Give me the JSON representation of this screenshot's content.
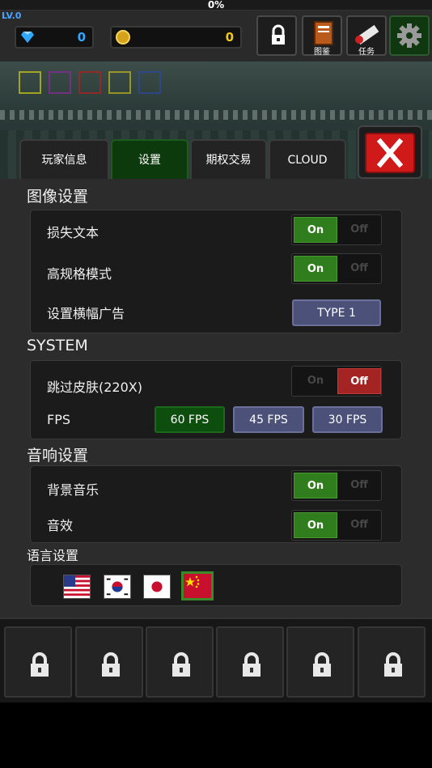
{
  "status": {
    "xp_percent_text": "0%",
    "level": "LV.0"
  },
  "currency": {
    "gems": "0",
    "coins": "0"
  },
  "top_buttons": [
    {
      "name": "lock",
      "caption": ""
    },
    {
      "name": "encyclopedia",
      "caption": "图鉴"
    },
    {
      "name": "quests",
      "caption": "任务"
    },
    {
      "name": "settings",
      "caption": ""
    }
  ],
  "tabs": [
    {
      "label": "玩家信息",
      "active": false
    },
    {
      "label": "设置",
      "active": true
    },
    {
      "label": "期权交易",
      "active": false
    },
    {
      "label": "CLOUD",
      "active": false
    }
  ],
  "graphics": {
    "title": "图像设置",
    "rows": [
      {
        "label": "损失文本",
        "on": "On",
        "off": "Off",
        "state": "on"
      },
      {
        "label": "高规格模式",
        "on": "On",
        "off": "Off",
        "state": "on"
      }
    ],
    "banner": {
      "label": "设置横幅广告",
      "button": "TYPE 1"
    }
  },
  "system": {
    "title": "SYSTEM",
    "skip_skin": {
      "label": "跳过皮肤(220X)",
      "on": "On",
      "off": "Off",
      "state": "off"
    },
    "fps": {
      "label": "FPS",
      "options": [
        "60 FPS",
        "45 FPS",
        "30 FPS"
      ],
      "selected": "60 FPS"
    }
  },
  "audio": {
    "title": "音响设置",
    "rows": [
      {
        "label": "背景音乐",
        "on": "On",
        "off": "Off",
        "state": "on"
      },
      {
        "label": "音效",
        "on": "On",
        "off": "Off",
        "state": "on"
      }
    ]
  },
  "language": {
    "title": "语言设置",
    "flags": [
      "us-flag",
      "kr-flag",
      "jp-flag",
      "cn-flag"
    ],
    "selected": "cn-flag"
  },
  "lock_slots": 6,
  "colors": {
    "accent_green": "#2f7d1c",
    "off_red": "#a42424",
    "gem_blue": "#2fa8ff",
    "coin_gold": "#f0c419",
    "close_red": "#d01a1a"
  }
}
